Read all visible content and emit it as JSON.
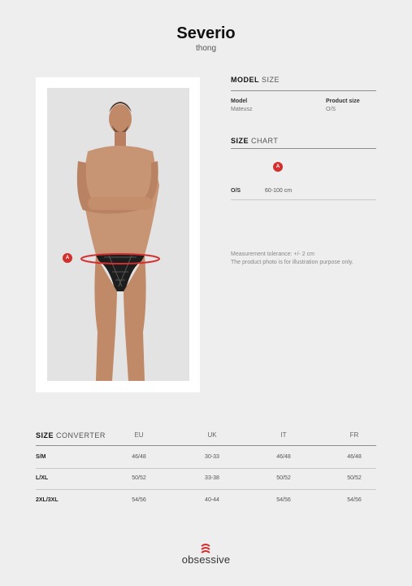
{
  "header": {
    "title": "Severio",
    "subtitle": "thong"
  },
  "photo": {
    "badge": "A"
  },
  "model_size": {
    "title_bold": "MODEL",
    "title_light": "SIZE",
    "model_label": "Model",
    "model_value": "Mateusz",
    "size_label": "Product size",
    "size_value": "O/S"
  },
  "size_chart": {
    "title_bold": "SIZE",
    "title_light": "CHART",
    "badge": "A",
    "rows": [
      {
        "size": "O/S",
        "value": "60-100 cm"
      }
    ]
  },
  "notes": {
    "tolerance": "Measurement tolerance: +/- 2 cm",
    "disclaimer": "The product photo is for illustration purpose only."
  },
  "converter": {
    "title_bold": "SIZE",
    "title_light": "CONVERTER",
    "columns": [
      "EU",
      "UK",
      "IT",
      "FR"
    ],
    "rows": [
      {
        "size": "S/M",
        "values": [
          "46/48",
          "30-33",
          "46/48",
          "46/48"
        ]
      },
      {
        "size": "L/XL",
        "values": [
          "50/52",
          "33-38",
          "50/52",
          "50/52"
        ]
      },
      {
        "size": "2XL/3XL",
        "values": [
          "54/56",
          "40-44",
          "54/56",
          "54/56"
        ]
      }
    ]
  },
  "brand": {
    "name": "obsessive",
    "accent_color": "#d32f2f"
  }
}
